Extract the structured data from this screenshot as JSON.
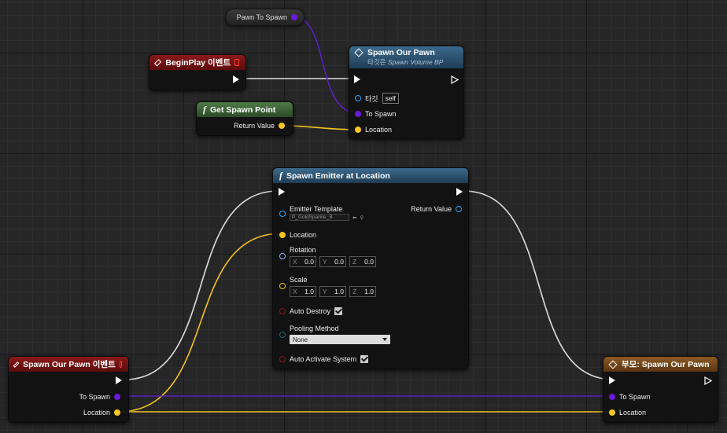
{
  "variable_node": {
    "label": "Pawn To Spawn"
  },
  "begin_play": {
    "title": "BeginPlay 이벤트"
  },
  "get_spawn_point": {
    "title": "Get Spawn Point",
    "return_label": "Return Value"
  },
  "spawn_our_pawn_call": {
    "title": "Spawn Our Pawn",
    "subtitle_ko": "타깃은",
    "subtitle": "Spawn Volume BP",
    "target_label": "타깃",
    "target_value": "self",
    "to_spawn_label": "To Spawn",
    "location_label": "Location"
  },
  "spawn_emitter": {
    "title": "Spawn Emitter at Location",
    "emitter_template_label": "Emitter Template",
    "emitter_template_value": "P_GoldSparkle_B",
    "return_label": "Return Value",
    "location_label": "Location",
    "rotation_label": "Rotation",
    "rotation": {
      "x": "0.0",
      "y": "0.0",
      "z": "0.0"
    },
    "scale_label": "Scale",
    "scale": {
      "x": "1.0",
      "y": "1.0",
      "z": "1.0"
    },
    "axis": {
      "x": "X",
      "y": "Y",
      "z": "Z"
    },
    "auto_destroy_label": "Auto Destroy",
    "pooling_method_label": "Pooling Method",
    "pooling_method_value": "None",
    "auto_activate_label": "Auto Activate System"
  },
  "spawn_event": {
    "title": "Spawn Our Pawn 이벤트",
    "to_spawn_label": "To Spawn",
    "location_label": "Location"
  },
  "parent_call": {
    "title": "부모: Spawn Our Pawn",
    "to_spawn_label": "To Spawn",
    "location_label": "Location"
  },
  "colors": {
    "exec_wire": "#e0e0e0",
    "vector_wire": "#f2c31d",
    "object_wire": "#5a1fc2",
    "event_header": "#7a1515",
    "function_header": "#2f5674",
    "pure_header": "#3f6a3a",
    "parent_header": "#7a4a1c"
  }
}
